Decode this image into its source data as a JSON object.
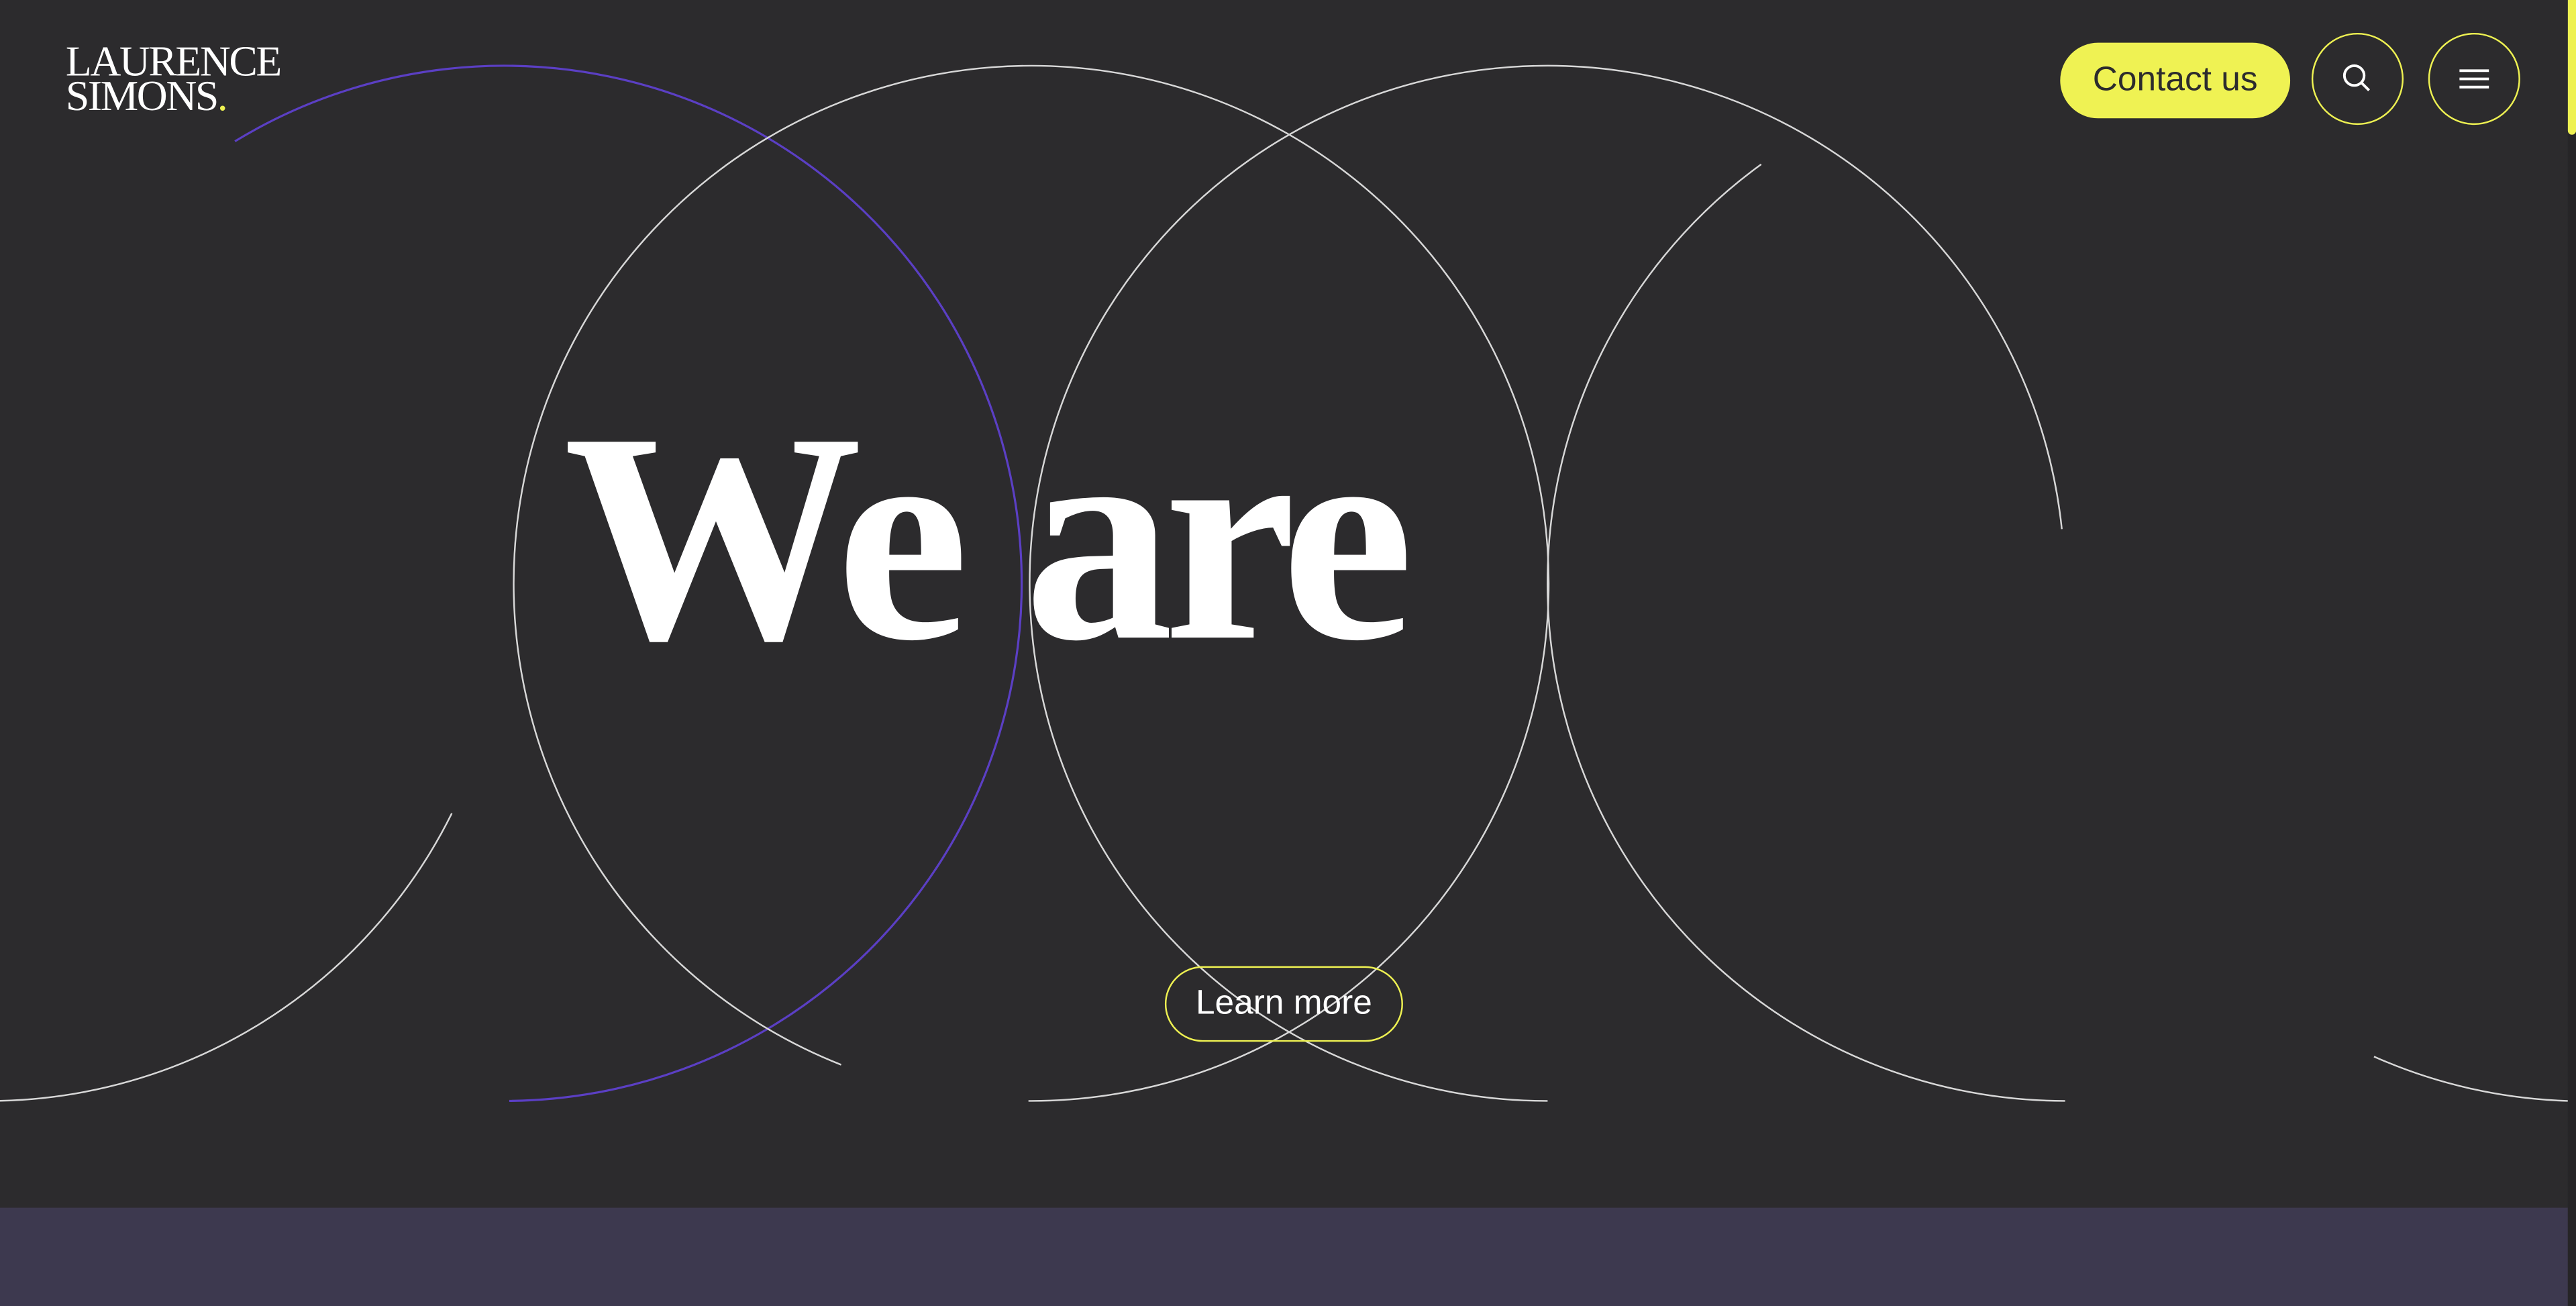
{
  "header": {
    "logo_line1": "LAURENCE",
    "logo_line2": "SIMONS",
    "logo_dot": ".",
    "contact_label": "Contact us",
    "search_icon": "search-icon",
    "menu_icon": "hamburger-menu-icon"
  },
  "hero": {
    "headline": "We are",
    "learn_more_label": "Learn more"
  },
  "colors": {
    "background": "#2c2b2d",
    "accent_yellow": "#eff253",
    "accent_purple": "#5b3fc4",
    "band": "#3d394f"
  }
}
